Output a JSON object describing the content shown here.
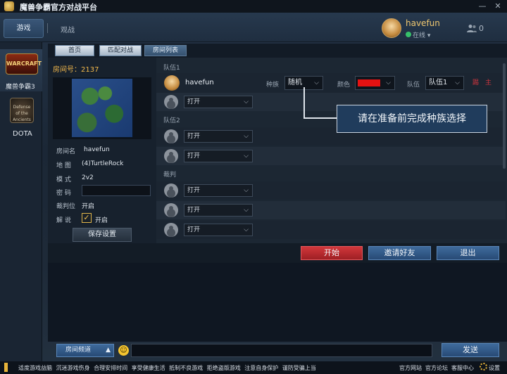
{
  "window": {
    "title": "魔兽争霸官方对战平台",
    "minimize": "—",
    "close": "✕"
  },
  "header": {
    "nav_game": "游戏",
    "nav_watch": "观战",
    "username": "havefun",
    "status": "在线 ▾",
    "friends_count": "0"
  },
  "sidebar": {
    "items": [
      {
        "label": "魔兽争霸3",
        "logo": "WARCRAFT"
      },
      {
        "label": "DOTA",
        "logo": "Defense of the Ancients"
      }
    ]
  },
  "tabs": [
    "首页",
    "匹配对战",
    "房间列表"
  ],
  "room": {
    "number": "房间号：2137",
    "fields": [
      {
        "label": "房间名",
        "value": "havefun"
      },
      {
        "label": "地  图",
        "value": "(4)TurtleRock"
      },
      {
        "label": "模  式",
        "value": "2v2"
      },
      {
        "label": "密  码",
        "value": ""
      },
      {
        "label": "裁判位",
        "value": "开启"
      },
      {
        "label": "解  说",
        "value": "开启"
      }
    ],
    "commentary_checked": "✓",
    "save_button": "保存设置"
  },
  "slots": {
    "team1_label": "队伍1",
    "team2_label": "队伍2",
    "referee_label": "裁判",
    "player1": {
      "name": "havefun",
      "race_label": "种族",
      "race": "随机",
      "color_label": "颜色",
      "color": "#e51212",
      "team_label": "队伍",
      "team": "队伍1",
      "kick": "踢",
      "host": "主"
    },
    "open": "打开",
    "arrow": "⌵"
  },
  "tooltip": "请在准备前完成种族选择",
  "actions": {
    "start": "开始",
    "invite": "邀请好友",
    "exit": "退出"
  },
  "chat": {
    "channel": "房间频道",
    "channel_arrow": "▲",
    "emoji": "☺",
    "send": "发送"
  },
  "footer": {
    "notice": "适度游戏益脑 沉迷游戏伤身 合理安排时间 享受健康生活 抵制不良游戏 拒绝盗版游戏 注意自身保护 谨防受骗上当",
    "links": [
      "官方网站",
      "官方论坛",
      "客服中心"
    ],
    "settings": "设置"
  }
}
